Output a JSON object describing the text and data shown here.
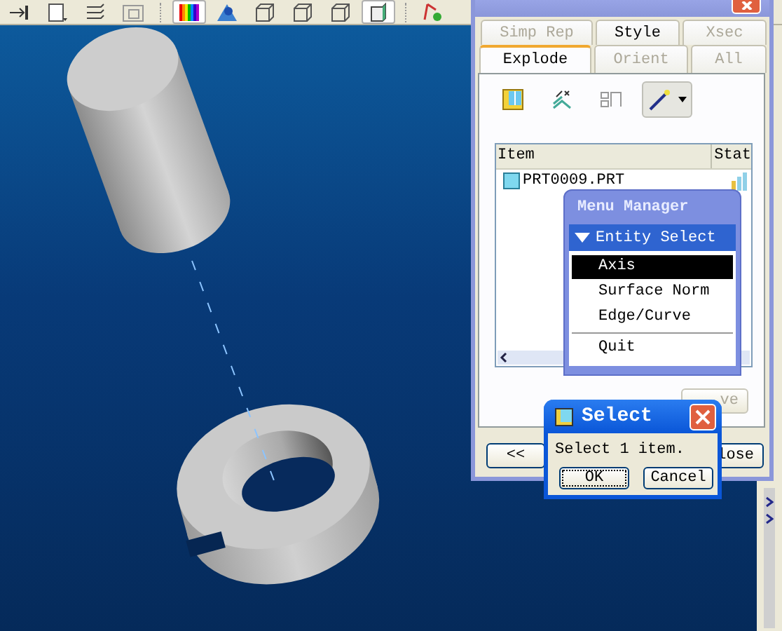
{
  "toolbar": {
    "groups": [
      [
        {
          "kind": "insert",
          "pressed": false
        },
        {
          "kind": "new",
          "pressed": false
        },
        {
          "kind": "layers",
          "pressed": false
        },
        {
          "kind": "views",
          "pressed": false
        }
      ],
      [
        {
          "kind": "color",
          "pressed": true
        },
        {
          "kind": "appearance",
          "pressed": false
        },
        {
          "kind": "wireframe",
          "pressed": false
        },
        {
          "kind": "hidden",
          "pressed": false
        },
        {
          "kind": "nohidden",
          "pressed": false
        },
        {
          "kind": "shading",
          "pressed": true
        }
      ],
      [
        {
          "kind": "datum",
          "pressed": false
        }
      ]
    ]
  },
  "view_manager": {
    "tabs_top": [
      {
        "label": "Simp Rep",
        "selected": false,
        "disabled": true
      },
      {
        "label": "Style",
        "selected": false,
        "disabled": false
      },
      {
        "label": "Xsec",
        "selected": false,
        "disabled": true
      }
    ],
    "tabs_bottom": [
      {
        "label": "Explode",
        "selected": true,
        "disabled": false
      },
      {
        "label": "Orient",
        "selected": false,
        "disabled": true
      },
      {
        "label": "All",
        "selected": false,
        "disabled": true
      }
    ],
    "tools": [
      {
        "kind": "view",
        "pressed": false
      },
      {
        "kind": "explode",
        "pressed": false
      },
      {
        "kind": "unexplode",
        "pressed": false
      },
      {
        "kind": "position",
        "pressed": true
      }
    ],
    "list": {
      "columns": [
        "Item",
        "Stat"
      ],
      "rows": [
        {
          "item": "PRT0009.PRT"
        }
      ]
    },
    "remove_button": {
      "label": "ve",
      "disabled": true
    },
    "buttons": [
      "<<",
      "lose"
    ]
  },
  "menu_manager": {
    "title": "Menu Manager",
    "section": {
      "label": "Entity Select",
      "expanded": true
    },
    "items": [
      {
        "label": "Axis",
        "selected": true
      },
      {
        "label": "Surface Norm",
        "selected": false
      },
      {
        "label": "Edge/Curve",
        "selected": false
      }
    ],
    "quit": "Quit"
  },
  "select_dialog": {
    "title": "Select",
    "message": "Select 1 item.",
    "buttons": [
      {
        "label": "OK",
        "focused": true
      },
      {
        "label": "Cancel",
        "focused": false
      }
    ]
  }
}
